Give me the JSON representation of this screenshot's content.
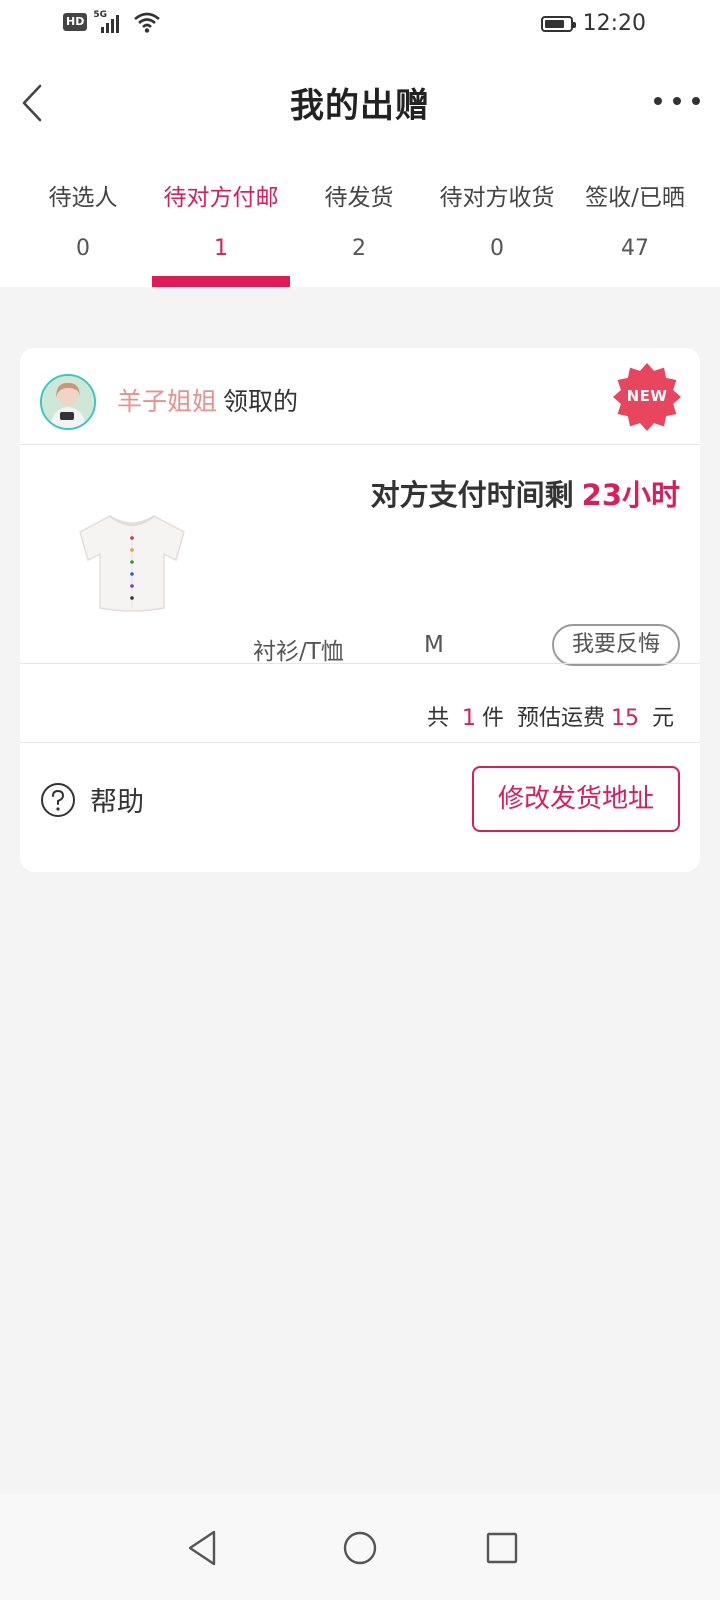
{
  "status_bar": {
    "hd": "HD",
    "network": "5G",
    "time": "12:20",
    "battery_level": 0.8
  },
  "nav": {
    "title": "我的出赠"
  },
  "tabs": [
    {
      "label": "待选人",
      "count": "0",
      "active": false
    },
    {
      "label": "待对方付邮",
      "count": "1",
      "active": true
    },
    {
      "label": "待发货",
      "count": "2",
      "active": false
    },
    {
      "label": "待对方收货",
      "count": "0",
      "active": false
    },
    {
      "label": "签收/已晒",
      "count": "47",
      "active": false
    }
  ],
  "order": {
    "receiver_name": "羊子姐姐",
    "receiver_suffix": "领取的",
    "badge": "NEW",
    "countdown_label": "对方支付时间剩",
    "countdown_value": "23小时",
    "item_category": "衬衫/T恤",
    "item_size": "M",
    "regret_button": "我要反悔",
    "summary": {
      "total_prefix": "共",
      "item_count": "1",
      "item_unit": "件",
      "shipping_label": "预估运费",
      "shipping_fee": "15",
      "currency": "元"
    },
    "help_label": "帮助",
    "address_button": "修改发货地址"
  },
  "colors": {
    "accent": "#d81e5b",
    "receiver_name": "#e8928f",
    "badge": "#e8465e",
    "avatar_ring": "#35c7c0"
  }
}
